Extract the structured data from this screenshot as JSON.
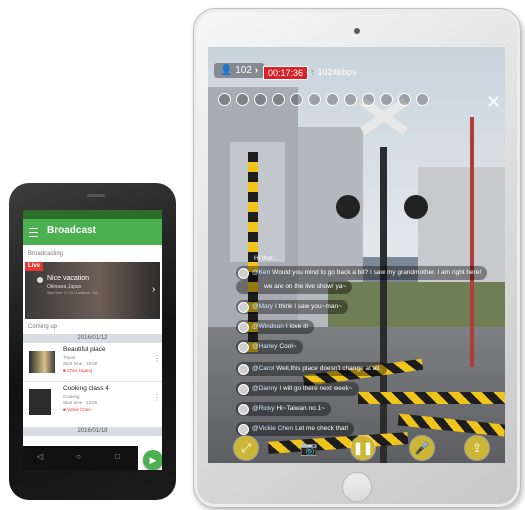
{
  "tablet": {
    "viewer_count": "102",
    "viewers_icon": "person-icon",
    "timer": "00:17:36",
    "bitrate": "1024kbps",
    "bitrate_icon": "arrow-up-icon",
    "close_icon": "close-icon",
    "chat": [
      {
        "user": "",
        "text": "Hi that..."
      },
      {
        "user": "@Ken",
        "text": "Would you mind to go back a bit? I saw my grandmother. I am right here!"
      },
      {
        "user": "",
        "text": "we are on the live show! ya~"
      },
      {
        "user": "@Mary",
        "text": "I think I saw you~man~"
      },
      {
        "user": "@Windsun",
        "text": "I love it!"
      },
      {
        "user": "@Harley",
        "text": "Cool~"
      },
      {
        "user": "@Carol",
        "text": "Well,this place doesn't change at all."
      },
      {
        "user": "@Danny",
        "text": "I will go there next week~"
      },
      {
        "user": "@Ricky",
        "text": "Hi~Taiwan no.1~"
      },
      {
        "user": "@Vickie Chen",
        "text": "Let me check that!"
      }
    ],
    "controls": [
      "fullscreen-icon",
      "camera-icon",
      "pause-icon",
      "microphone-icon",
      "share-icon"
    ],
    "accent_color": "#cbb735",
    "timer_color": "#d8232a"
  },
  "phone": {
    "app_title": "Broadcast",
    "section_broadcasting": "Broadcasting",
    "live_badge": "Live",
    "live_item": {
      "title": "Nice vacation",
      "location": "Okinawa,Japan",
      "meta": "Start time: 17:34 / Audience: 100"
    },
    "section_coming_up": "Coming up",
    "dates": [
      "2016/01/12",
      "2016/01/18"
    ],
    "items": [
      {
        "title": "Beautiful place",
        "sub": "Travel",
        "time": "Start time : 18:00",
        "user": "Chris Huang"
      },
      {
        "title": "Cooking class 4",
        "sub": "Cooking",
        "time": "Start time : 12:00",
        "user": "Vickie Chen"
      }
    ],
    "nav_keys": [
      "◁",
      "○",
      "□"
    ],
    "brand_color": "#4caf50"
  }
}
